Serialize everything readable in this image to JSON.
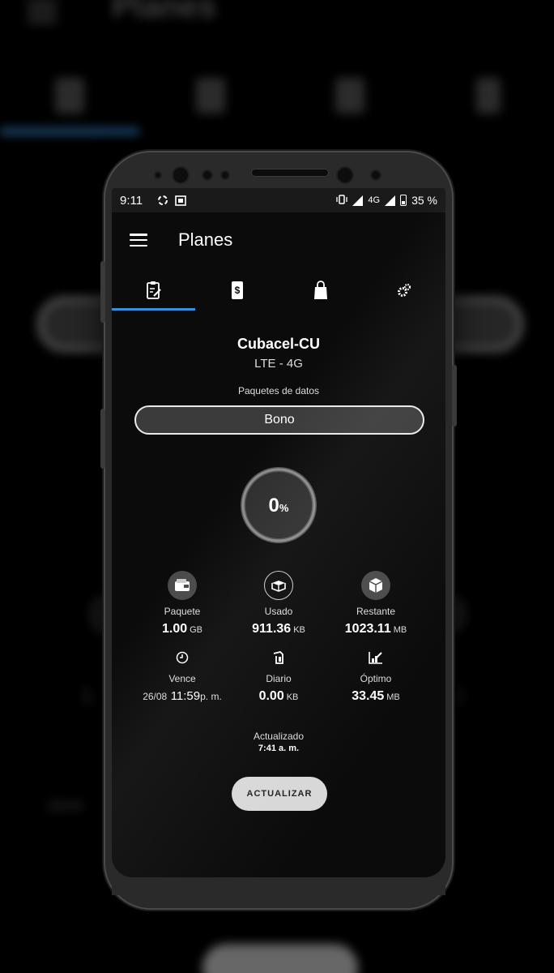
{
  "app": {
    "title": "Planes"
  },
  "status_bar": {
    "time": "9:11",
    "network_type": "4G",
    "battery": "35 %"
  },
  "tabs": [
    {
      "icon": "clipboard-edit-icon",
      "selected": true
    },
    {
      "icon": "phone-dollar-icon",
      "selected": false
    },
    {
      "icon": "shopping-bag-icon",
      "selected": false
    },
    {
      "icon": "gears-icon",
      "selected": false
    }
  ],
  "plan": {
    "carrier": "Cubacel-CU",
    "network": "LTE - 4G",
    "package_label": "Paquetes de datos",
    "package_selected": "Bono",
    "usage_percent": "0",
    "usage_percent_sign": "%"
  },
  "stats": {
    "paquete": {
      "label": "Paquete",
      "value": "1.00",
      "unit": "GB",
      "icon": "wallet-icon"
    },
    "usado": {
      "label": "Usado",
      "value": "911.36",
      "unit": "KB",
      "icon": "open-box-icon"
    },
    "restante": {
      "label": "Restante",
      "value": "1023.11",
      "unit": "MB",
      "icon": "package-icon"
    },
    "vence": {
      "label": "Vence",
      "date": "26/08",
      "time": "11:59",
      "suffix": "p. m.",
      "icon": "clock-icon"
    },
    "diario": {
      "label": "Diario",
      "value": "0.00",
      "unit": "KB",
      "icon": "calendar-day-icon"
    },
    "optimo": {
      "label": "Óptimo",
      "value": "33.45",
      "unit": "MB",
      "icon": "chart-edit-icon"
    }
  },
  "updated": {
    "label": "Actualizado",
    "time": "7:41 a. m."
  },
  "refresh_button": "ACTUALIZAR",
  "colors": {
    "accent": "#3a8ed8",
    "background": "#0b0b0b",
    "button": "#d8d8d8"
  }
}
